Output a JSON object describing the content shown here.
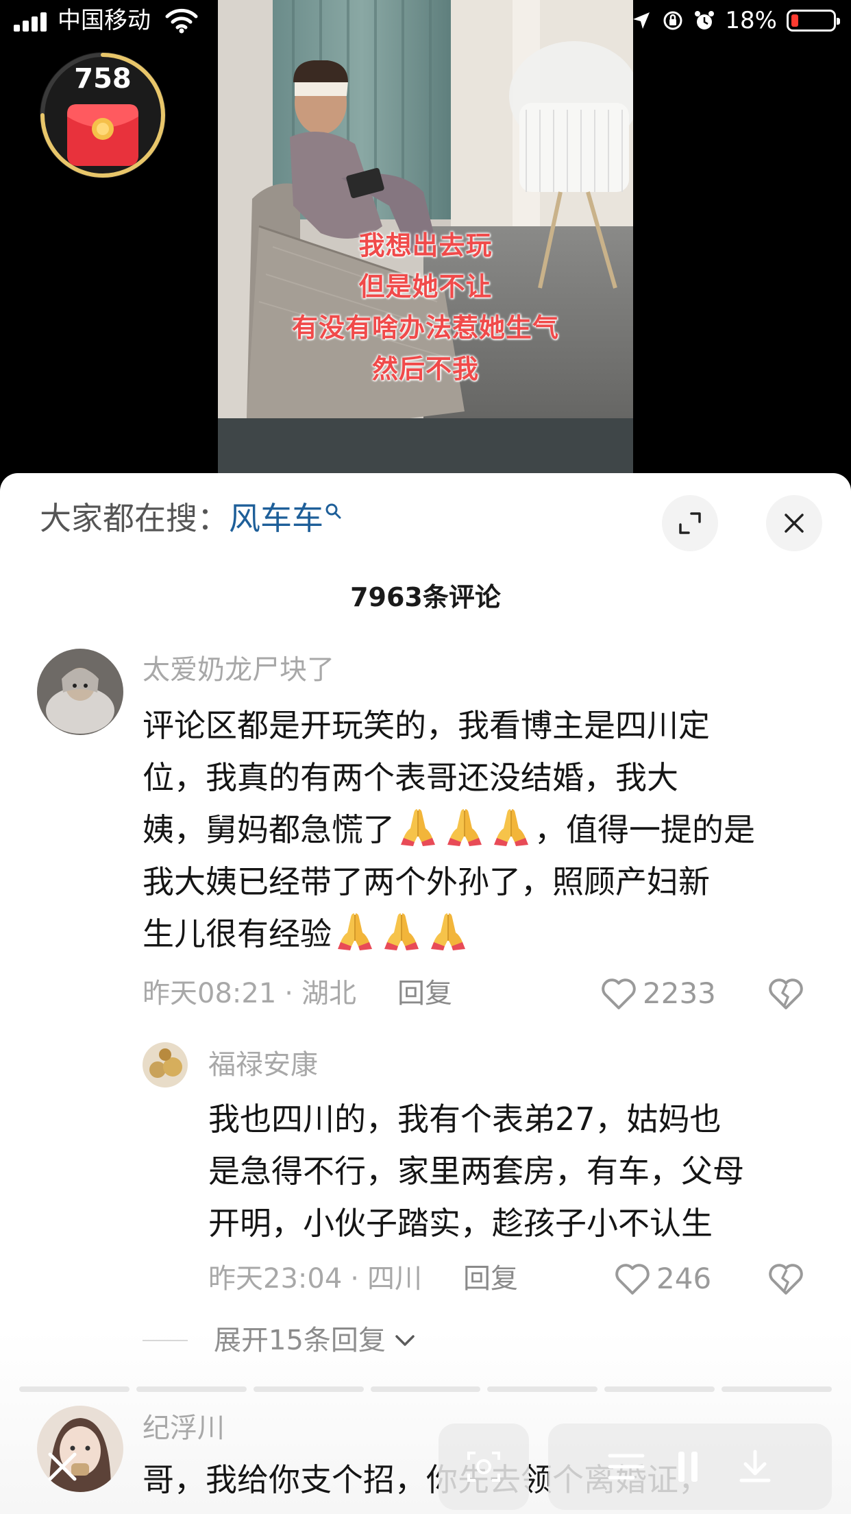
{
  "status_bar": {
    "carrier": "中国移动",
    "battery_percent": "18%",
    "battery_level": 0.18,
    "battery_color": "#ff3b30"
  },
  "reward_widget": {
    "count": "758",
    "icon": "red-envelope-icon",
    "progress": 0.75
  },
  "video": {
    "caption_lines": [
      "我想出去玩",
      "但是她不让",
      "有没有啥办法惹她生气",
      "然后不我"
    ],
    "caption_color": "#f04a4a"
  },
  "sheet": {
    "search_label": "大家都在搜：",
    "search_keyword": "风车车",
    "search_keyword_color": "#1e5f99",
    "comment_count": "7963条评论",
    "expand_icon": "fullscreen-icon",
    "close_icon": "close-icon"
  },
  "comments": [
    {
      "username": "太爱奶龙尸块了",
      "lines": [
        "评论区都是开玩笑的，我看博主是四川定",
        "位，我真的有两个表哥还没结婚，我大",
        "姨，舅妈都急慌了",
        "，值得一提的是",
        "我大姨已经带了两个外孙了，照顾产妇新",
        "生儿很有经验"
      ],
      "time": "昨天08:21",
      "separator": "·",
      "location": "湖北",
      "reply_label": "回复",
      "likes": "2233"
    },
    {
      "username": "纪浮川",
      "text": "哥，我给你支个招，你先去领个离婚证，"
    }
  ],
  "reply": {
    "username": "福禄安康",
    "lines": [
      "我也四川的，我有个表弟27，姑妈也",
      "是急得不行，家里两套房，有车，父母",
      "开明，小伙子踏实，趁孩子小不认生"
    ],
    "time": "昨天23:04",
    "separator": "·",
    "location": "四川",
    "reply_label": "回复",
    "likes": "246"
  },
  "expand_replies": {
    "label": "展开15条回复",
    "icon": "chevron-down-icon"
  },
  "bottom_controls": {
    "icons": [
      "close-icon",
      "scan-icon",
      "playlist-icon",
      "download-icon"
    ]
  },
  "emoji": "folded-hands-emoji"
}
